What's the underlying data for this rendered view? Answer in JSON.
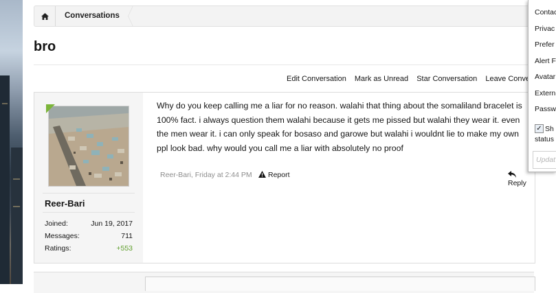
{
  "breadcrumb": {
    "section": "Conversations"
  },
  "conversation": {
    "title": "bro"
  },
  "actions": [
    "Edit Conversation",
    "Mark as Unread",
    "Star Conversation",
    "Leave Convers"
  ],
  "message": {
    "author": "Reer-Bari",
    "stats": [
      {
        "label": "Joined:",
        "value": "Jun 19, 2017"
      },
      {
        "label": "Messages:",
        "value": "711"
      },
      {
        "label": "Ratings:",
        "value": "+553"
      }
    ],
    "body": "Why do you keep calling me a liar for no reason. walahi that thing about the somaliland bracelet is 100% fact. i always question them walahi because it gets me pissed but walahi they wear it. even the men wear it. i can only speak for bosaso and garowe but walahi i wouldnt lie to make my own ppl look bad. why would you call me a liar with absolutely no proof",
    "meta": "Reer-Bari, Friday at 2:44 PM",
    "report_label": "Report",
    "reply_label": "Reply"
  },
  "account_menu": {
    "items": [
      "Contac",
      "Privac",
      "Prefer",
      "Alert F",
      "Avatar",
      "Extern",
      "Passw"
    ],
    "status_check_label": "Sh",
    "status_label": "status",
    "status_placeholder": "Updat"
  },
  "colors": {
    "online": "#7cb53a",
    "positive_rating": "#5d9d2a"
  }
}
